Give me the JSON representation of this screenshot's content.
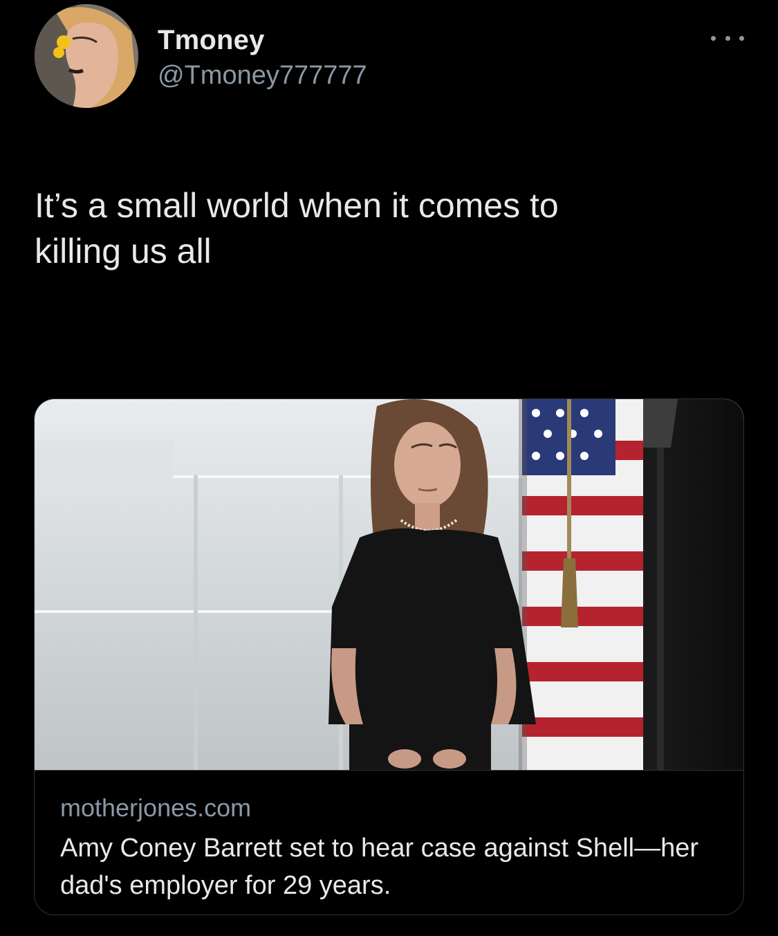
{
  "tweet": {
    "author": {
      "display_name": "Tmoney",
      "handle": "@Tmoney777777",
      "avatar_icon": "user-avatar-photo"
    },
    "more_icon": "more-options-icon",
    "text": "It’s a small world when it comes to\nkilling us all",
    "link_card": {
      "domain": "motherjones.com",
      "title": "Amy Coney Barrett set to hear case against Shell—her dad's employer for 29 years.",
      "image_icon": "news-photo"
    }
  },
  "colors": {
    "background": "#000000",
    "primary_text": "#e7e9ea",
    "secondary_text": "#8b98a5",
    "border": "#2f3336"
  }
}
